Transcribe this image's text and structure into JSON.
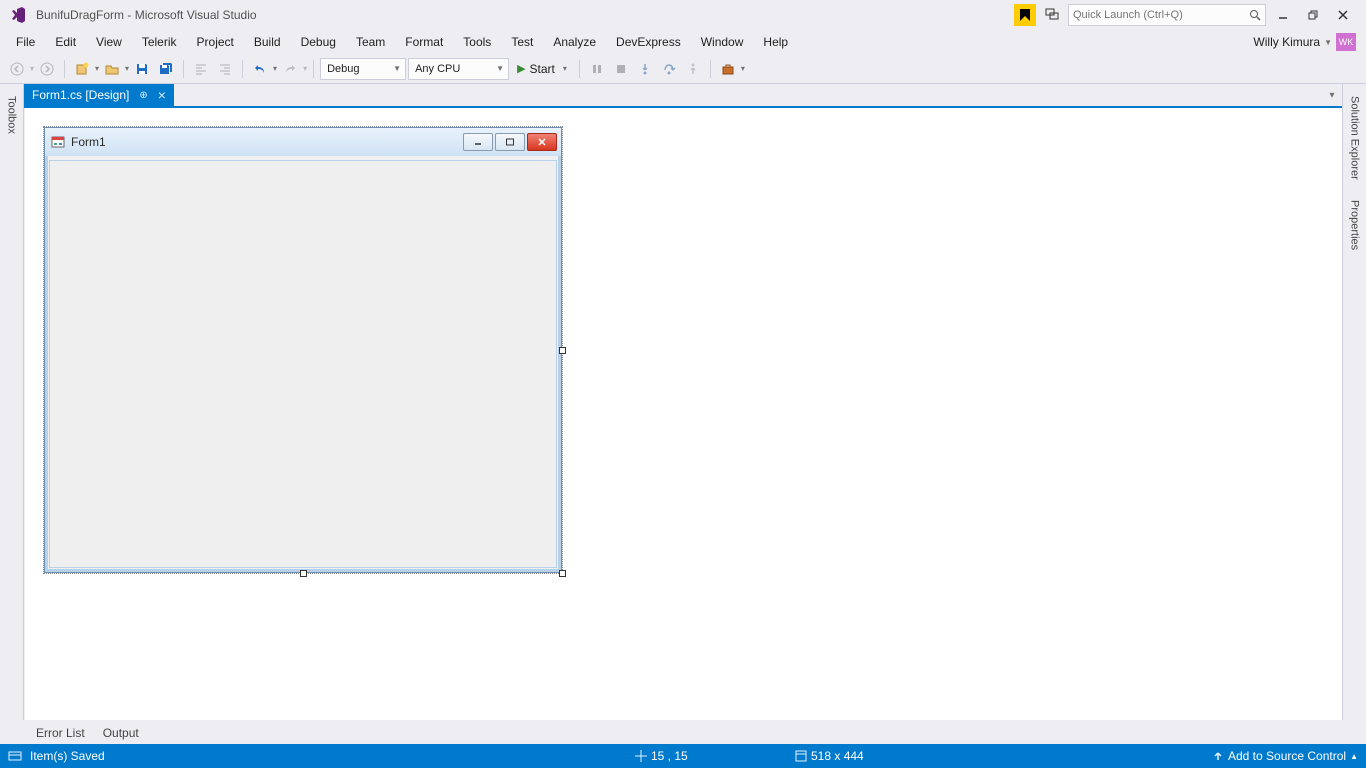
{
  "title": "BunifuDragForm - Microsoft Visual Studio",
  "quick_launch_placeholder": "Quick Launch (Ctrl+Q)",
  "user_name": "Willy Kimura",
  "user_initials": "WK",
  "menu": [
    "File",
    "Edit",
    "View",
    "Telerik",
    "Project",
    "Build",
    "Debug",
    "Team",
    "Format",
    "Tools",
    "Test",
    "Analyze",
    "DevExpress",
    "Window",
    "Help"
  ],
  "toolbar": {
    "config": "Debug",
    "platform": "Any CPU",
    "start_label": "Start"
  },
  "tab": {
    "label": "Form1.cs [Design]"
  },
  "form": {
    "title": "Form1"
  },
  "bottom_tabs": [
    "Error List",
    "Output"
  ],
  "right_panes": [
    "Solution Explorer",
    "Properties"
  ],
  "left_pane": "Toolbox",
  "status": {
    "saved": "Item(s) Saved",
    "pos": "15 , 15",
    "size": "518 x 444",
    "source_control": "Add to Source Control"
  }
}
